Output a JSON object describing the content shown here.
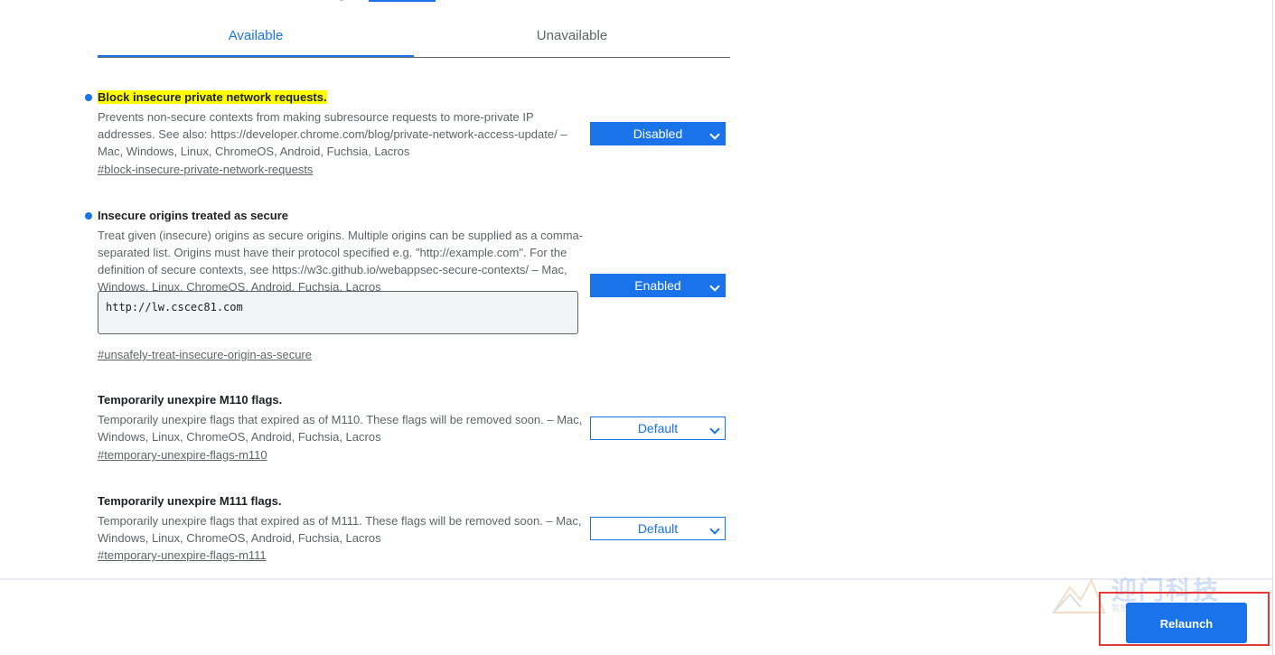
{
  "tabs": {
    "available": "Available",
    "unavailable": "Unavailable"
  },
  "flags": [
    {
      "name": "Block insecure private network requests.",
      "description": "Prevents non-secure contexts from making subresource requests to more-private IP addresses. See also: https://developer.chrome.com/blog/private-network-access-update/ – Mac, Windows, Linux, ChromeOS, Android, Fuchsia, Lacros",
      "link": "#block-insecure-private-network-requests",
      "state": "Disabled"
    },
    {
      "name": "Insecure origins treated as secure",
      "description": "Treat given (insecure) origins as secure origins. Multiple origins can be supplied as a comma-separated list. Origins must have their protocol specified e.g. \"http://example.com\". For the definition of secure contexts, see https://w3c.github.io/webappsec-secure-contexts/ – Mac, Windows, Linux, ChromeOS, Android, Fuchsia, Lacros",
      "origins_value": "http://lw.cscec81.com",
      "link": "#unsafely-treat-insecure-origin-as-secure",
      "state": "Enabled"
    },
    {
      "name": "Temporarily unexpire M110 flags.",
      "description": "Temporarily unexpire flags that expired as of M110. These flags will be removed soon. – Mac, Windows, Linux, ChromeOS, Android, Fuchsia, Lacros",
      "link": "#temporary-unexpire-flags-m110",
      "state": "Default"
    },
    {
      "name": "Temporarily unexpire M111 flags.",
      "description": "Temporarily unexpire flags that expired as of M111. These flags will be removed soon. – Mac, Windows, Linux, ChromeOS, Android, Fuchsia, Lacros",
      "link": "#temporary-unexpire-flags-m111",
      "state": "Default"
    }
  ],
  "footer": {
    "relaunch_label": "Relaunch",
    "watermark_text": "迎门科技",
    "watermark_sub": "智慧生活 科技引领"
  },
  "colors": {
    "accent": "#1a73e8",
    "highlight": "#ffff00",
    "frame": "#e53935"
  },
  "icons": [
    "chevron-down-icon",
    "watermark-logo-icon"
  ]
}
